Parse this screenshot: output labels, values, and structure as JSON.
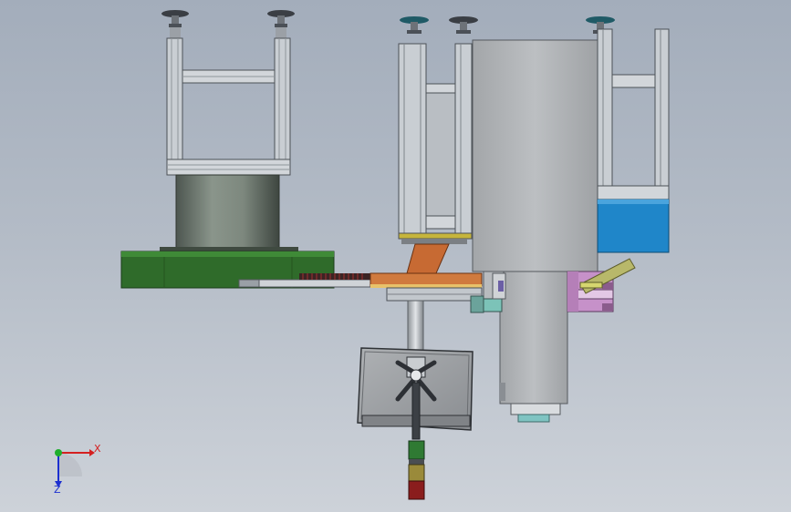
{
  "viewport": {
    "view_name": "cad-model-front-view"
  },
  "triad": {
    "x_label": "X",
    "z_label": "Z",
    "colors": {
      "x": "#d42020",
      "y": "#1fae2c",
      "z": "#1c2fd0"
    }
  },
  "colors": {
    "frame": "#c9ced3",
    "frame_dark": "#5a5f66",
    "cylinder": "#6f7a70",
    "base_plate": "#2f6b2a",
    "main_body": "#b2b5b8",
    "blue_bin": "#1f86c9",
    "orange_bracket": "#c76a33",
    "purple_block": "#c691c9",
    "gripper_panel": "#9a9da1",
    "tower_green": "#2f7a33",
    "tower_yellow": "#9a8a3a",
    "tower_red": "#8a1d1d"
  }
}
